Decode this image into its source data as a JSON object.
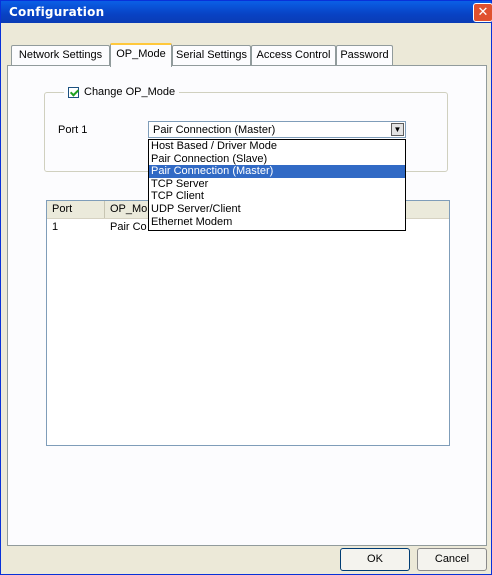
{
  "window": {
    "title": "Configuration"
  },
  "tabs": [
    {
      "label": "Network Settings",
      "active": false
    },
    {
      "label": "OP_Mode",
      "active": true
    },
    {
      "label": "Serial Settings",
      "active": false
    },
    {
      "label": "Access Control",
      "active": false
    },
    {
      "label": "Password",
      "active": false
    }
  ],
  "op_mode": {
    "change_label": "Change OP_Mode",
    "change_checked": true,
    "port_label": "Port 1",
    "selected_value": "Pair Connection (Master)",
    "options": [
      "Host Based / Driver Mode",
      "Pair Connection (Slave)",
      "Pair Connection (Master)",
      "TCP Server",
      "TCP Client",
      "UDP Server/Client",
      "Ethernet Modem"
    ],
    "highlighted_option": "Pair Connection (Master)"
  },
  "table": {
    "columns": [
      "Port",
      "OP_Mo"
    ],
    "rows": [
      {
        "port": "1",
        "op_mode": "Pair Co"
      }
    ]
  },
  "buttons": {
    "ok": "OK",
    "cancel": "Cancel"
  },
  "icons": {
    "close": "close-icon",
    "dropdown": "chevron-down-icon",
    "check": "checkmark-icon"
  }
}
